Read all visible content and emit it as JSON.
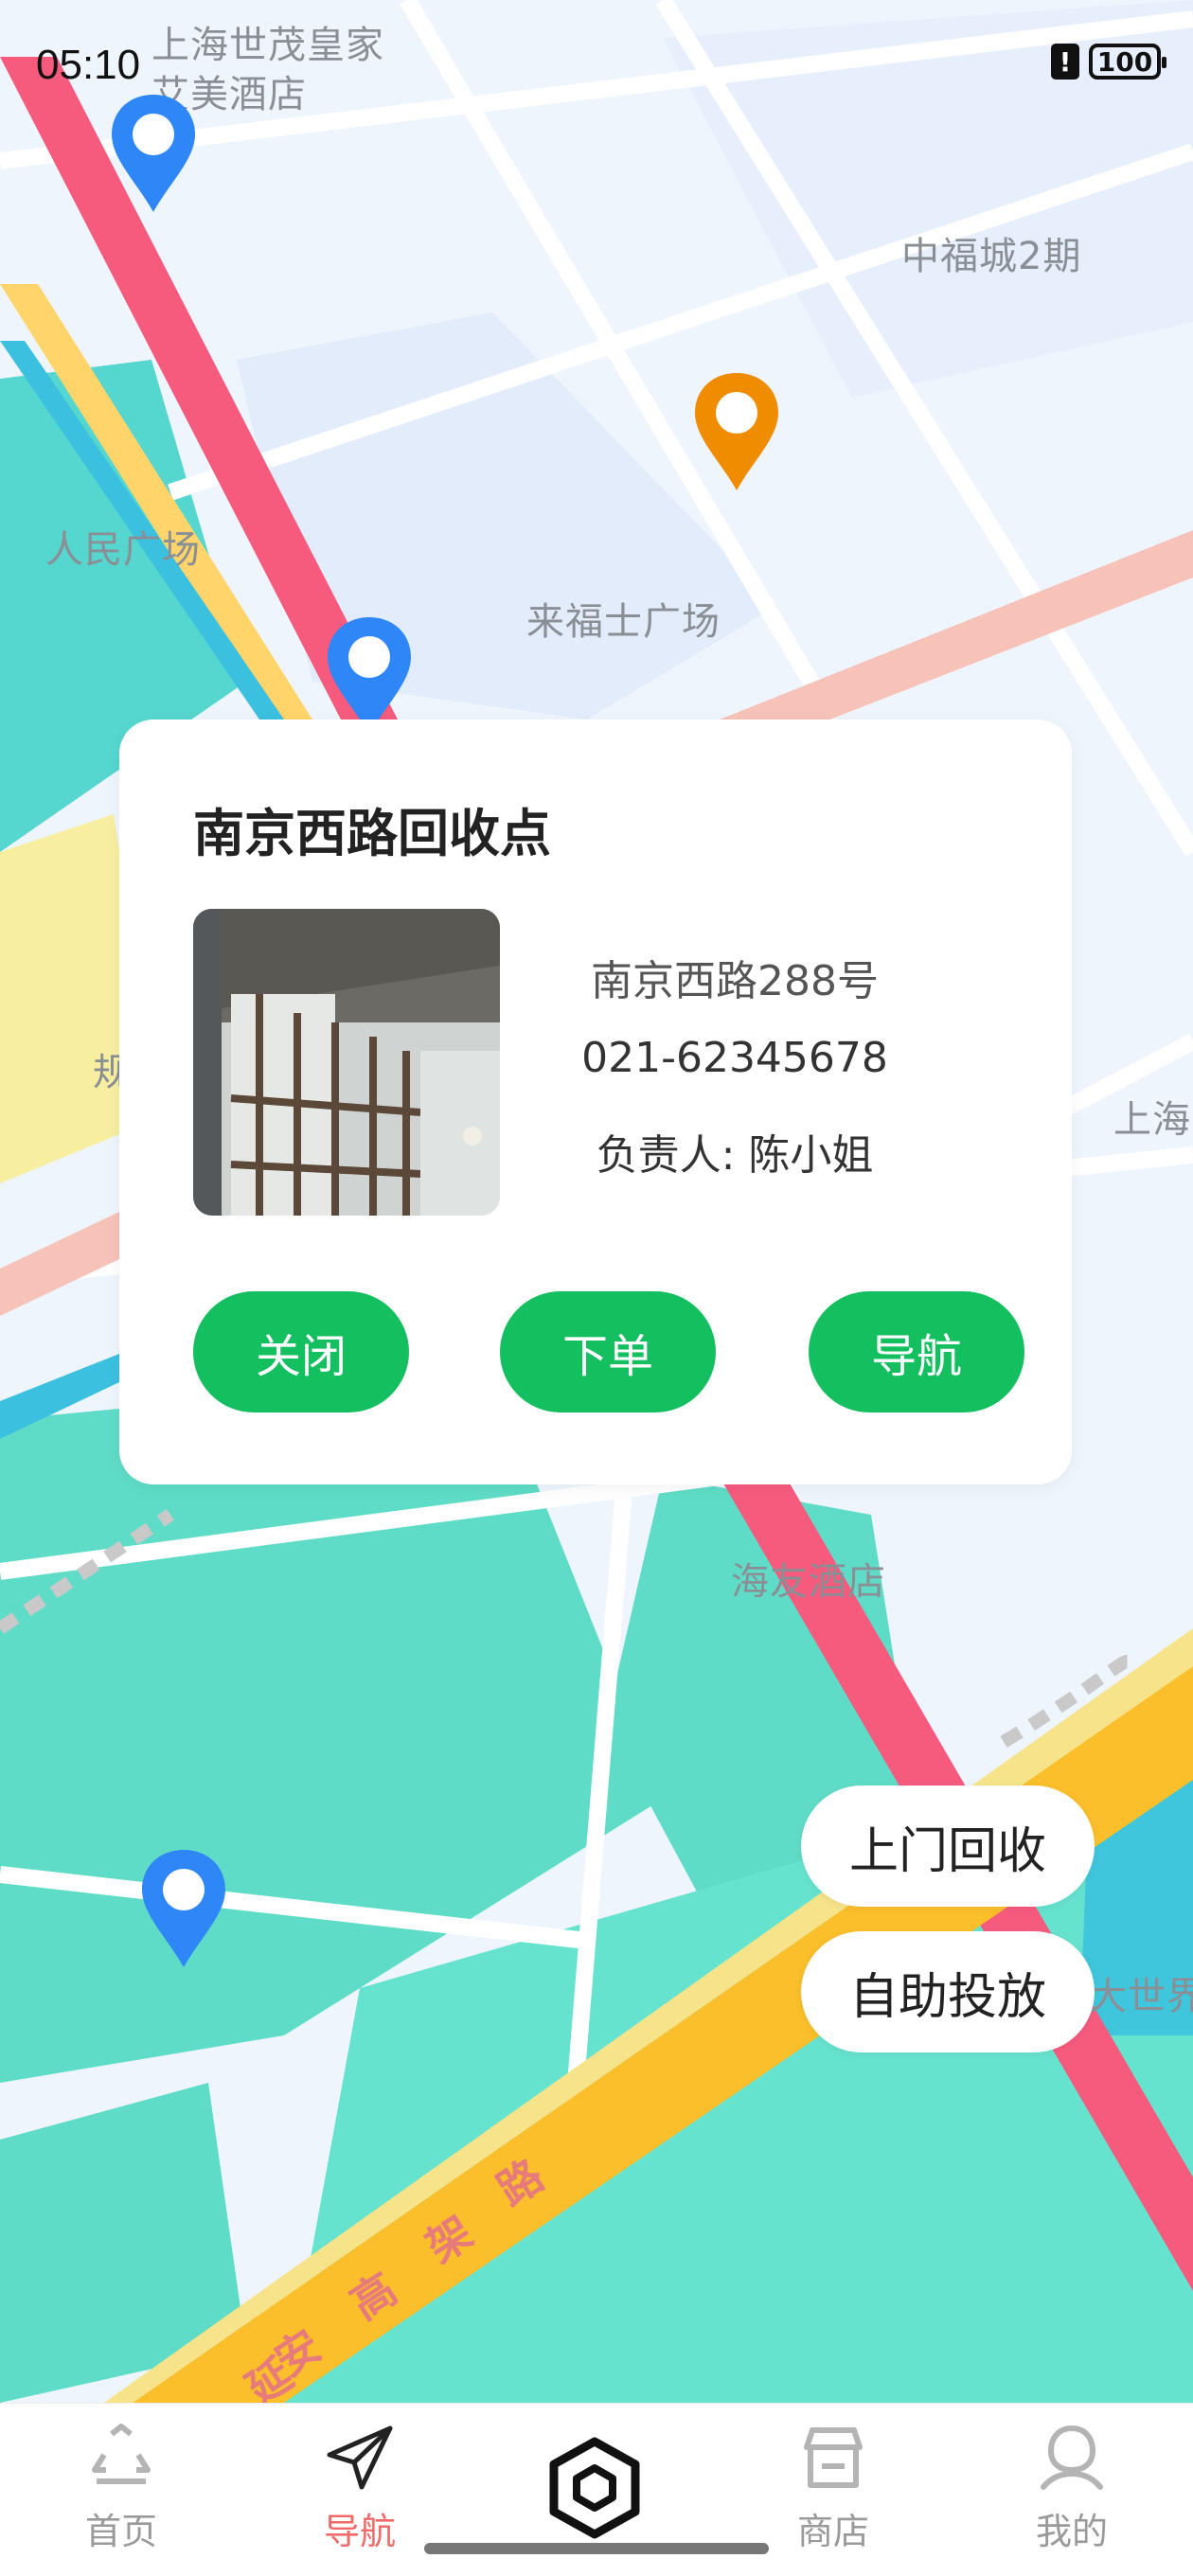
{
  "status_bar": {
    "time": "05:10",
    "alert": "!",
    "battery": "100"
  },
  "map": {
    "labels": {
      "hotel": "上海世茂皇家艾美酒店",
      "zhongfu": "中福城2期",
      "peoples_square": "人民广场",
      "raffles": "来福士广场",
      "haiyou": "海友酒店",
      "shanghai_edge": "上海",
      "gui_edge": "规",
      "world_edge": "大世界",
      "yanan_road": [
        "延",
        "安",
        "高",
        "架",
        "路"
      ]
    }
  },
  "popup": {
    "title": "南京西路回收点",
    "address": "南京西路288号",
    "phone": "021-62345678",
    "manager": "负责人: 陈小姐",
    "buttons": {
      "close": "关闭",
      "order": "下单",
      "navigate": "导航"
    }
  },
  "floating": {
    "door_pickup": "上门回收",
    "self_dropoff": "自助投放"
  },
  "tabbar": {
    "items": [
      {
        "label": "首页",
        "icon": "recycle-icon"
      },
      {
        "label": "导航",
        "icon": "paper-plane-icon",
        "active": true
      },
      {
        "label": "",
        "icon": "hexagon-scan-icon"
      },
      {
        "label": "商店",
        "icon": "store-icon"
      },
      {
        "label": "我的",
        "icon": "person-icon"
      }
    ]
  },
  "colors": {
    "accent_green": "#14bf5f",
    "active_tab": "#f06a6a",
    "pin_blue": "#2f86f6",
    "pin_orange": "#f08c00"
  }
}
